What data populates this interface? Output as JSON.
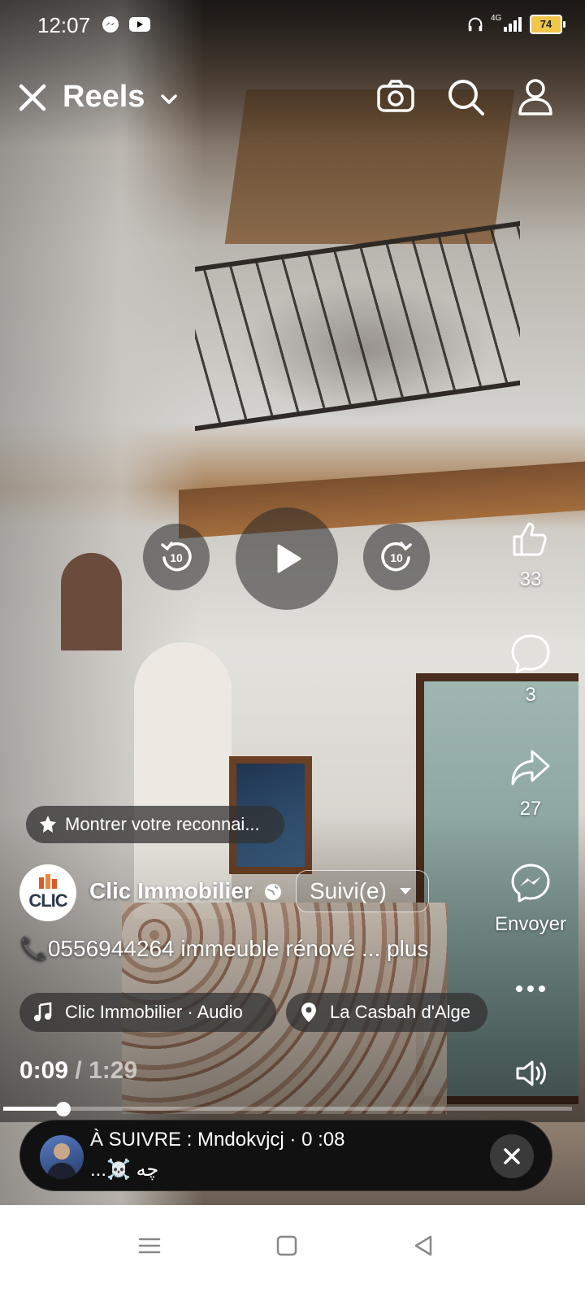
{
  "status_bar": {
    "time": "12:07",
    "battery": "74",
    "network": "4G"
  },
  "header": {
    "title": "Reels"
  },
  "reel": {
    "likes": "33",
    "comments": "3",
    "shares": "27",
    "send_label": "Envoyer",
    "recognition_chip": "Montrer votre reconnai...",
    "account_name": "Clic Immobilier",
    "avatar_text": "CLIC",
    "follow_label": "Suivi(e)",
    "caption": "📞0556944264 immeuble rénové ... plus",
    "audio_label": "Clic Immobilier · Audio",
    "location_label": "La Casbah d'Alge",
    "time_current": "0:09",
    "time_separator": "/",
    "time_total": "1:29",
    "progress_fraction": 0.106,
    "skip_back_label": "10",
    "skip_forward_label": "10"
  },
  "up_next": {
    "line1": "À SUIVRE : Mndokvjcj · 0 :08",
    "line2": "...☠️ چه"
  },
  "colors": {
    "accent": "#ffffff",
    "battery": "#f0c64b"
  }
}
